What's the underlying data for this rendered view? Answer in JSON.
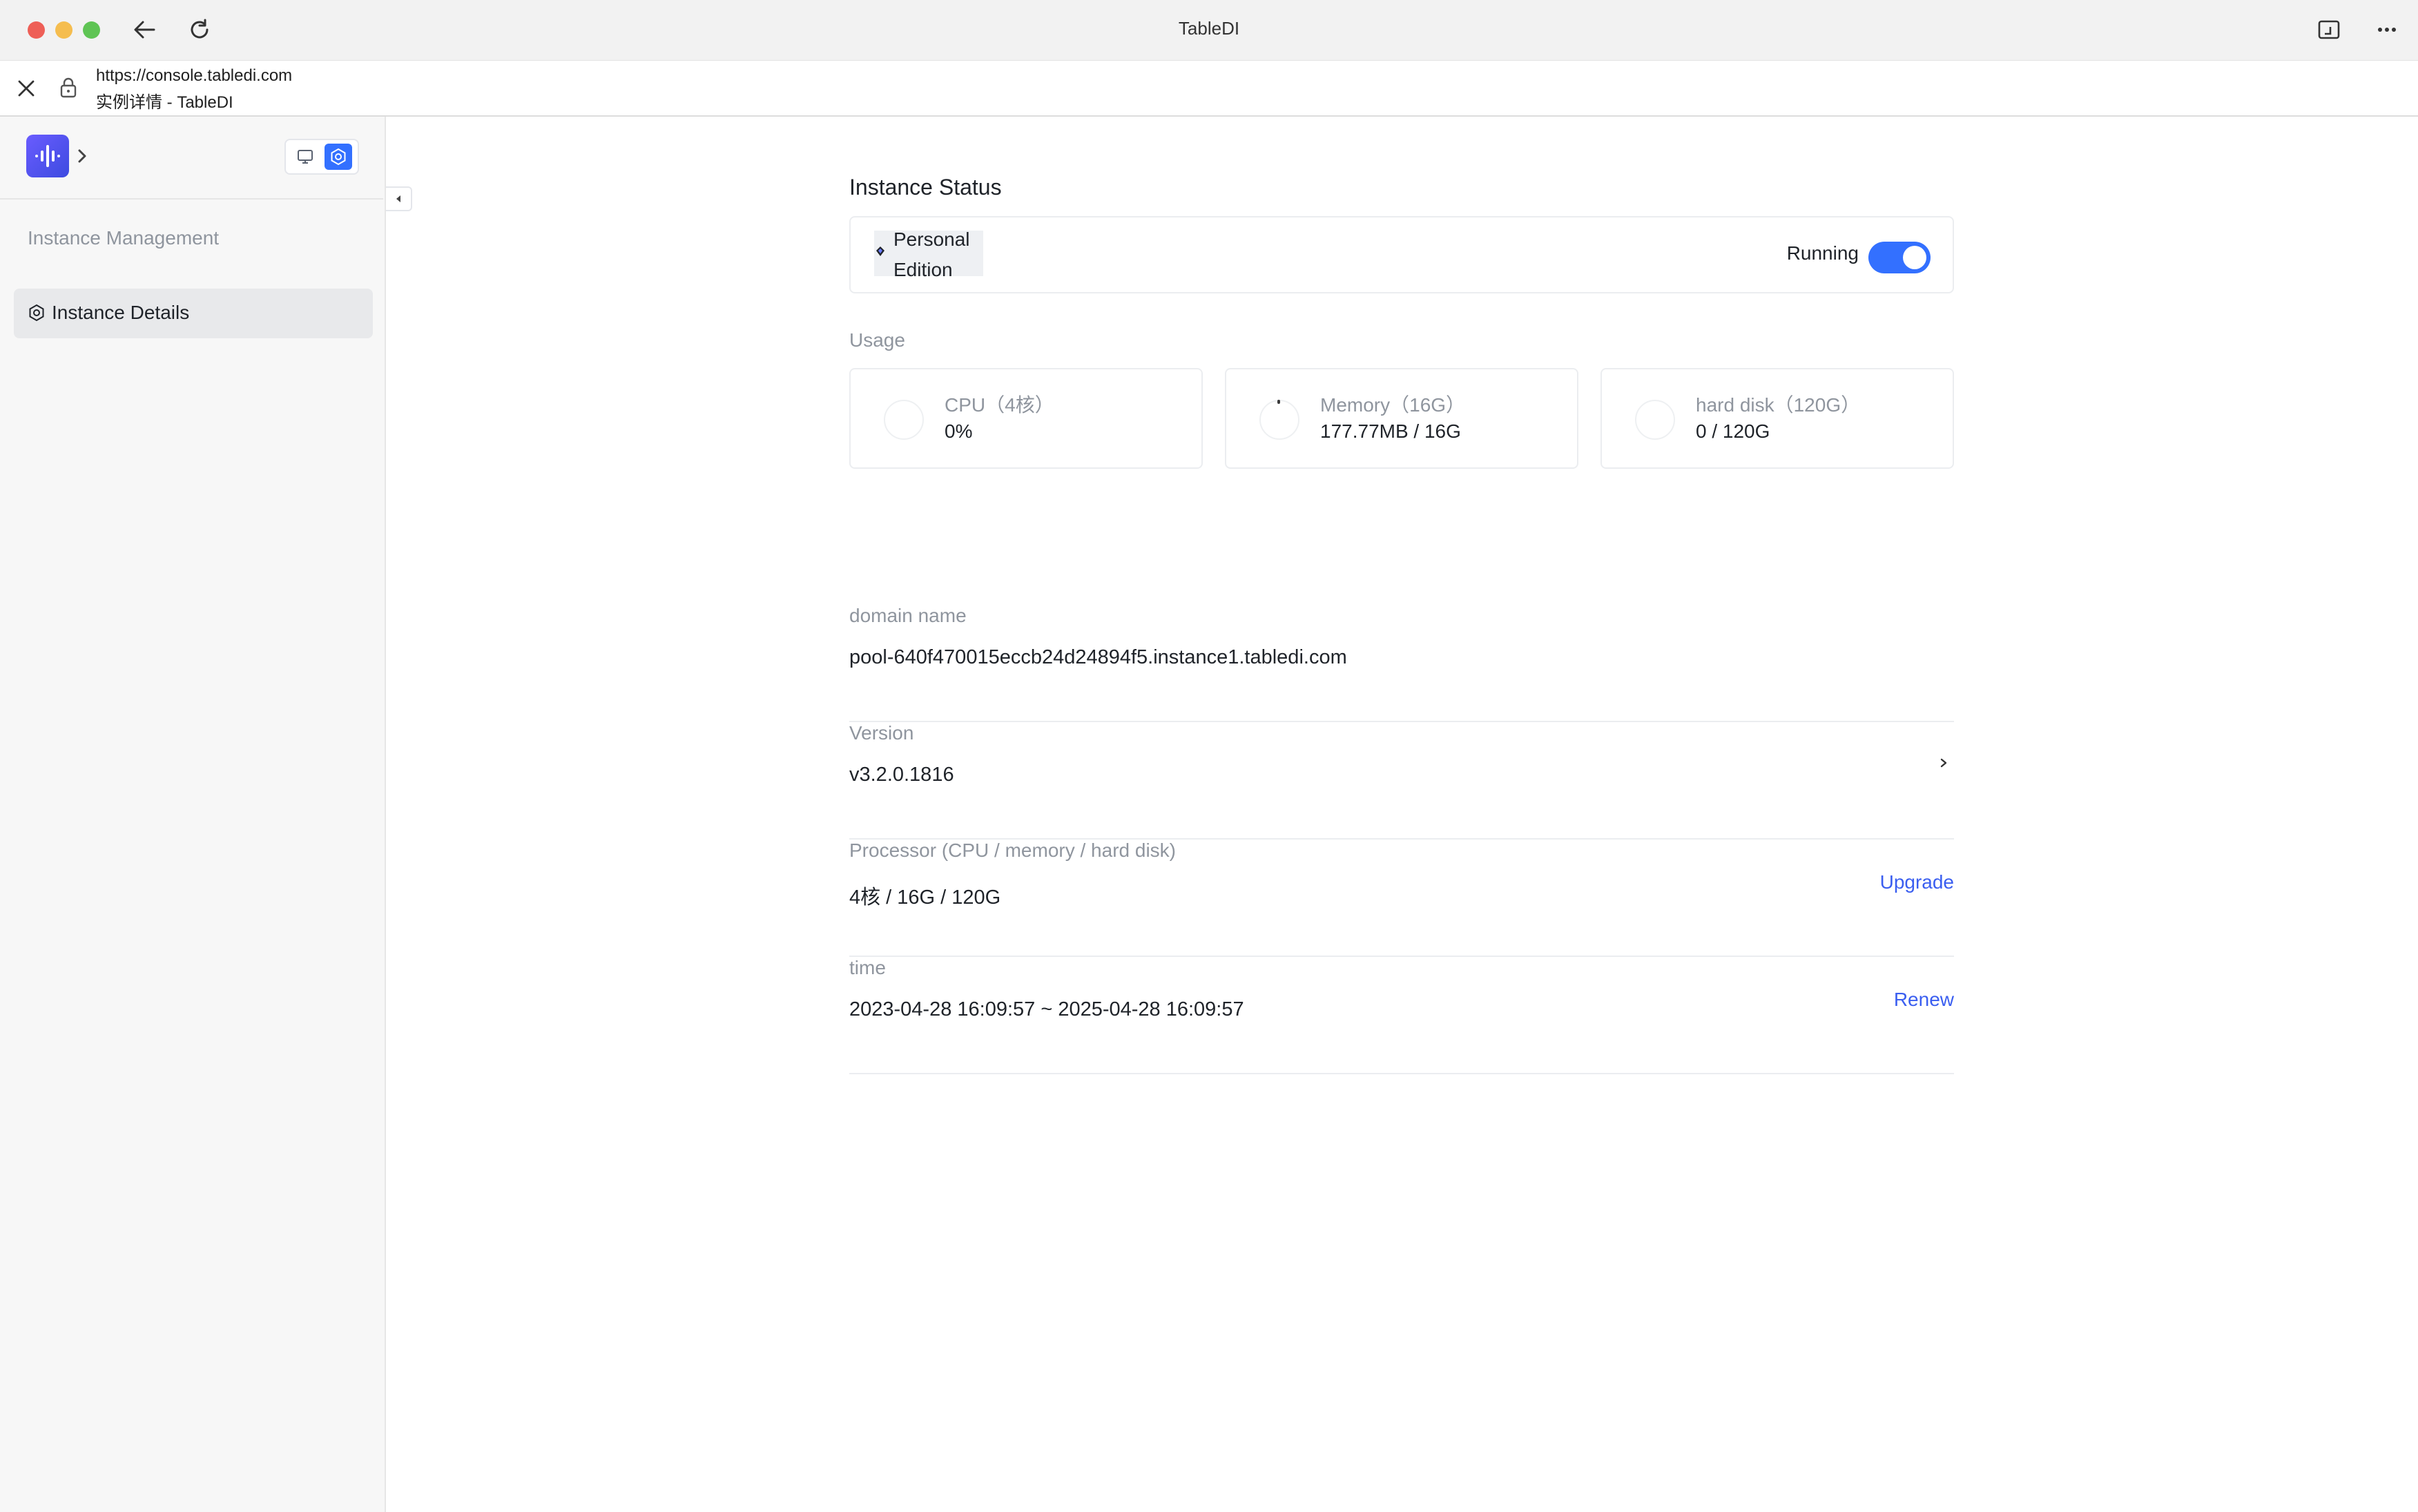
{
  "window": {
    "title": "TableDI"
  },
  "address_bar": {
    "url": "https://console.tabledi.com",
    "page_title": "实例详情 - TableDI"
  },
  "sidebar": {
    "section_label": "Instance Management",
    "items": [
      {
        "label": "Instance Details",
        "icon": "hexagon-gear-icon",
        "active": true
      }
    ]
  },
  "main": {
    "status_heading": "Instance Status",
    "edition": "Personal Edition",
    "running_label": "Running",
    "running_on": true,
    "usage_heading": "Usage",
    "usage": [
      {
        "label": "CPU（4核）",
        "value": "0%"
      },
      {
        "label": "Memory（16G）",
        "value": "177.77MB / 16G"
      },
      {
        "label": "hard disk（120G）",
        "value": "0 / 120G"
      }
    ],
    "info": [
      {
        "label": "domain name",
        "value": "pool-640f470015eccb24d24894f5.instance1.tabledi.com",
        "action": ""
      },
      {
        "label": "Version",
        "value": "v3.2.0.1816",
        "action": ""
      },
      {
        "label": "Processor (CPU / memory / hard disk)",
        "value": "4核 / 16G / 120G",
        "action": "Upgrade"
      },
      {
        "label": "time",
        "value": "2023-04-28 16:09:57 ~ 2025-04-28 16:09:57",
        "action": "Renew"
      }
    ]
  },
  "colors": {
    "accent": "#3370ff",
    "link": "#3a5ef0",
    "muted_text": "#8f959e",
    "sidebar_bg": "#f7f7f7"
  }
}
